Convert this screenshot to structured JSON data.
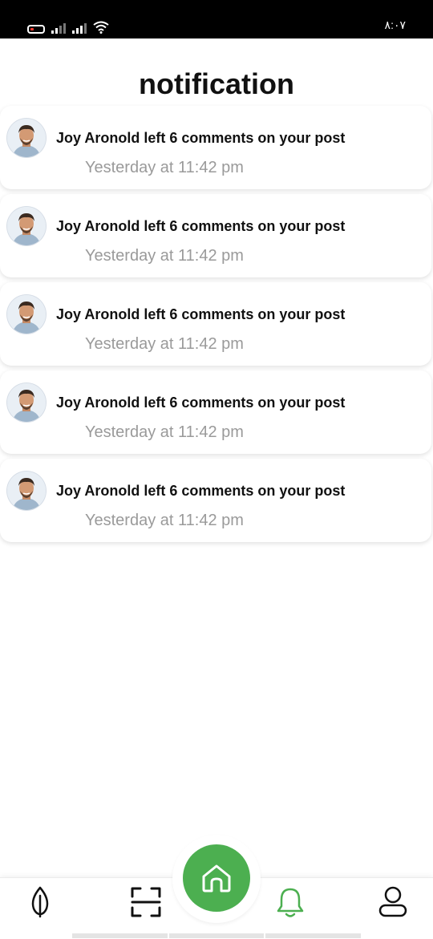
{
  "status_bar": {
    "time": "٨:٠٧",
    "battery_icon": "battery-low-icon",
    "signal_icons": [
      "signal-icon",
      "signal-icon"
    ],
    "wifi_icon": "wifi-icon"
  },
  "header": {
    "title": "notification"
  },
  "notifications": [
    {
      "avatar_icon": "user-avatar",
      "message": "Joy Aronold left 6 comments on your post",
      "time": "Yesterday at 11:42 pm"
    },
    {
      "avatar_icon": "user-avatar",
      "message": "Joy Aronold left 6 comments on your post",
      "time": "Yesterday at 11:42 pm"
    },
    {
      "avatar_icon": "user-avatar",
      "message": "Joy Aronold left 6 comments on your post",
      "time": "Yesterday at 11:42 pm"
    },
    {
      "avatar_icon": "user-avatar",
      "message": "Joy Aronold left 6 comments on your post",
      "time": "Yesterday at 11:42 pm"
    },
    {
      "avatar_icon": "user-avatar",
      "message": "Joy Aronold left 6 comments on your post",
      "time": "Yesterday at 11:42 pm"
    }
  ],
  "bottom_nav": {
    "items": [
      {
        "icon": "leaf-icon",
        "active": false
      },
      {
        "icon": "scan-icon",
        "active": false
      },
      {
        "icon": "home-icon",
        "active": false
      },
      {
        "icon": "bell-icon",
        "active": true
      },
      {
        "icon": "profile-icon",
        "active": false
      }
    ]
  },
  "colors": {
    "accent": "#4caf50",
    "text_primary": "#111111",
    "text_secondary": "#9a9a9a",
    "status_bar_bg": "#000000",
    "battery_low": "#ff3b30"
  }
}
